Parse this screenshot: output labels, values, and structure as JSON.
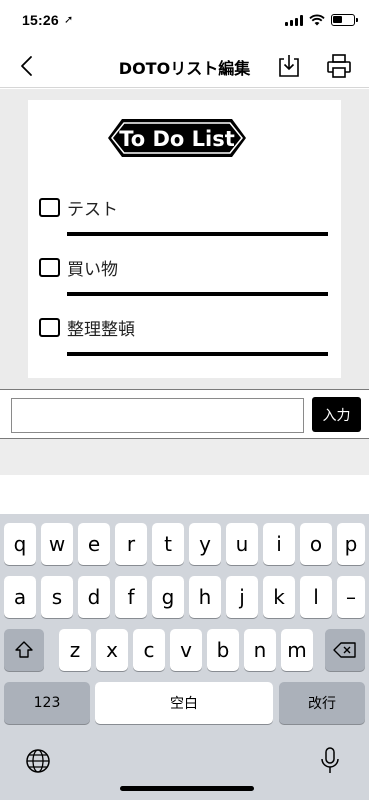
{
  "status_bar": {
    "time": "15:26",
    "location_glyph": "➚"
  },
  "nav": {
    "title": "DOTOリスト編集",
    "back_icon": "chevron-left-icon",
    "download_icon": "download-icon",
    "print_icon": "print-icon"
  },
  "card": {
    "logo_text": "To Do List",
    "items": [
      {
        "label": "テスト",
        "checked": false
      },
      {
        "label": "買い物",
        "checked": false
      },
      {
        "label": "整理整頓",
        "checked": false
      }
    ]
  },
  "input": {
    "value": "",
    "placeholder": "",
    "add_label": "入力"
  },
  "keyboard": {
    "row1": [
      "q",
      "w",
      "e",
      "r",
      "t",
      "y",
      "u",
      "i",
      "o",
      "p"
    ],
    "row2": [
      "a",
      "s",
      "d",
      "f",
      "g",
      "h",
      "j",
      "k",
      "l",
      "–"
    ],
    "row3": [
      "z",
      "x",
      "c",
      "v",
      "b",
      "n",
      "m"
    ],
    "numbers_label": "123",
    "space_label": "空白",
    "return_label": "改行"
  },
  "colors": {
    "background_gray": "#ebebeb",
    "keyboard_bg": "#d1d5db",
    "accent": "#000000"
  }
}
